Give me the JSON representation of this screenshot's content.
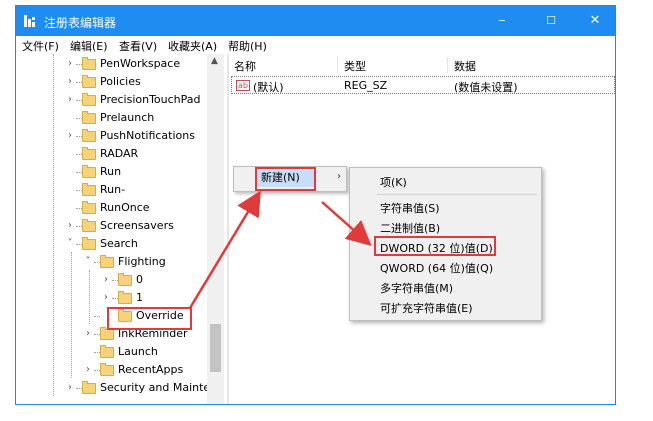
{
  "window": {
    "title": "注册表编辑器"
  },
  "titlebar": {
    "minimize_glyph": "–",
    "maximize_glyph": "☐",
    "close_glyph": "✕"
  },
  "menubar": {
    "items": [
      "文件(F)",
      "编辑(E)",
      "查看(V)",
      "收藏夹(A)",
      "帮助(H)"
    ]
  },
  "tree": {
    "items": [
      "PenWorkspace",
      "Policies",
      "PrecisionTouchPad",
      "Prelaunch",
      "PushNotifications",
      "RADAR",
      "Run",
      "Run-",
      "RunOnce",
      "Screensavers",
      "Search",
      "Flighting",
      "0",
      "1",
      "Override",
      "InkReminder",
      "Launch",
      "RecentApps",
      "Security and Mainte"
    ]
  },
  "values_pane": {
    "columns": [
      "名称",
      "类型",
      "数据"
    ],
    "rows": [
      {
        "name": "(默认)",
        "type": "REG_SZ",
        "data": "(数值未设置)"
      }
    ]
  },
  "context_menu": {
    "new_label": "新建(N)",
    "submenu_arrow": "›"
  },
  "submenu": {
    "items": [
      "项(K)",
      "字符串值(S)",
      "二进制值(B)",
      "DWORD (32 位)值(D)",
      "QWORD (64 位)值(Q)",
      "多字符串值(M)",
      "可扩充字符串值(E)"
    ]
  },
  "colors": {
    "titlebar": "#1e8cf0",
    "highlight": "#c6def7",
    "annotation": "#e03a3a"
  }
}
